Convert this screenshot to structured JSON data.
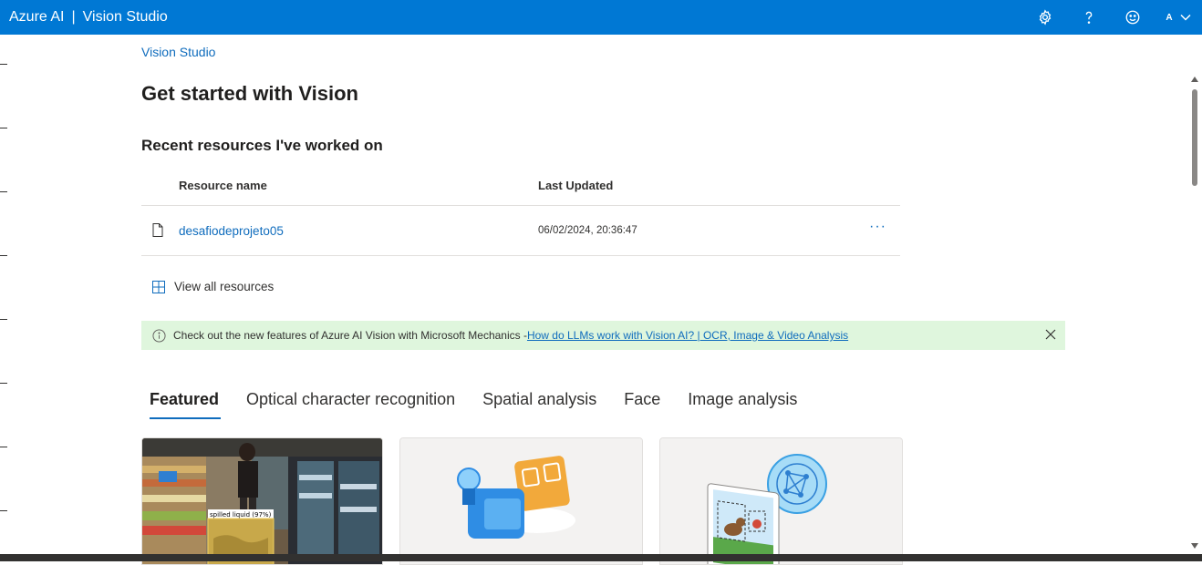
{
  "header": {
    "brand": "Azure AI",
    "separator": "|",
    "product": "Vision Studio",
    "avatar_letter": "A",
    "icons": [
      "gear-icon",
      "help-icon",
      "smiley-feedback-icon",
      "chevron-down-icon"
    ],
    "bar_color": "#0078d4"
  },
  "breadcrumb": "Vision Studio",
  "page_title": "Get started with Vision",
  "recent": {
    "title": "Recent resources I've worked on",
    "columns": [
      "Resource name",
      "Last Updated"
    ],
    "rows": [
      {
        "name": "desafiodeprojeto05",
        "updated": "06/02/2024, 20:36:47",
        "more": "···"
      }
    ],
    "view_all": "View all resources"
  },
  "banner": {
    "text": "Check out the new features of Azure AI Vision with Microsoft Mechanics - ",
    "link": "How do LLMs work with Vision AI? | OCR, Image & Video Analysis",
    "bg_color": "#dff6dd"
  },
  "tabs": [
    "Featured",
    "Optical character recognition",
    "Spatial analysis",
    "Face",
    "Image analysis"
  ],
  "active_tab": "Featured",
  "cards": {
    "card1_label": "spilled liquid (97%)"
  }
}
